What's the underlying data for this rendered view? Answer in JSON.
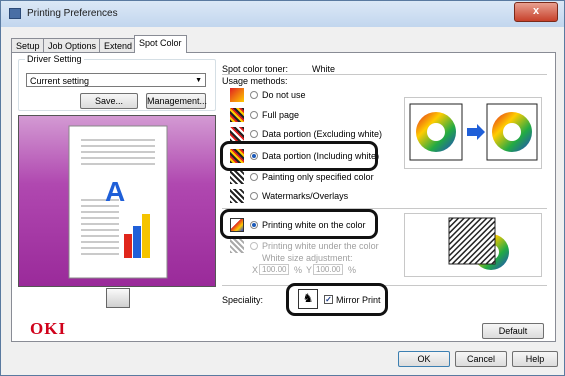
{
  "window": {
    "title": "Printing Preferences",
    "close_glyph": "x"
  },
  "tabs": [
    {
      "label": "Setup"
    },
    {
      "label": "Job Options"
    },
    {
      "label": "Extend"
    },
    {
      "label": "Spot Color"
    }
  ],
  "driver_setting": {
    "label": "Driver Setting",
    "selected": "Current setting",
    "save_label": "Save...",
    "management_label": "Management..."
  },
  "preview": {
    "letter": "A"
  },
  "spot_color": {
    "toner_label": "Spot color toner:",
    "toner_value": "White",
    "usage_label": "Usage methods:",
    "options": [
      {
        "label": "Do not use",
        "selected": false,
        "enabled": true
      },
      {
        "label": "Full page",
        "selected": false,
        "enabled": true
      },
      {
        "label": "Data portion (Excluding white)",
        "selected": false,
        "enabled": true
      },
      {
        "label": "Data portion (Including white)",
        "selected": true,
        "enabled": true
      },
      {
        "label": "Painting only specified color",
        "selected": false,
        "enabled": true
      },
      {
        "label": "Watermarks/Overlays",
        "selected": false,
        "enabled": true
      }
    ],
    "printing_options": [
      {
        "label": "Printing white on the color",
        "selected": true,
        "enabled": true
      },
      {
        "label": "Printing white under the color",
        "selected": false,
        "enabled": false
      }
    ],
    "white_size_label": "White size adjustment:",
    "white_size_x": "100.00",
    "white_size_y": "100.00",
    "white_size_x_unit": "%",
    "white_size_y_unit": "%",
    "x_label": "X",
    "y_label": "Y",
    "speciality_label": "Speciality:",
    "mirror_print_label": "Mirror Print",
    "mirror_print_checked": true
  },
  "brand": {
    "logo": "OKI",
    "color": "#d0021b"
  },
  "buttons": {
    "default_label": "Default",
    "ok_label": "OK",
    "cancel_label": "Cancel",
    "help_label": "Help"
  }
}
